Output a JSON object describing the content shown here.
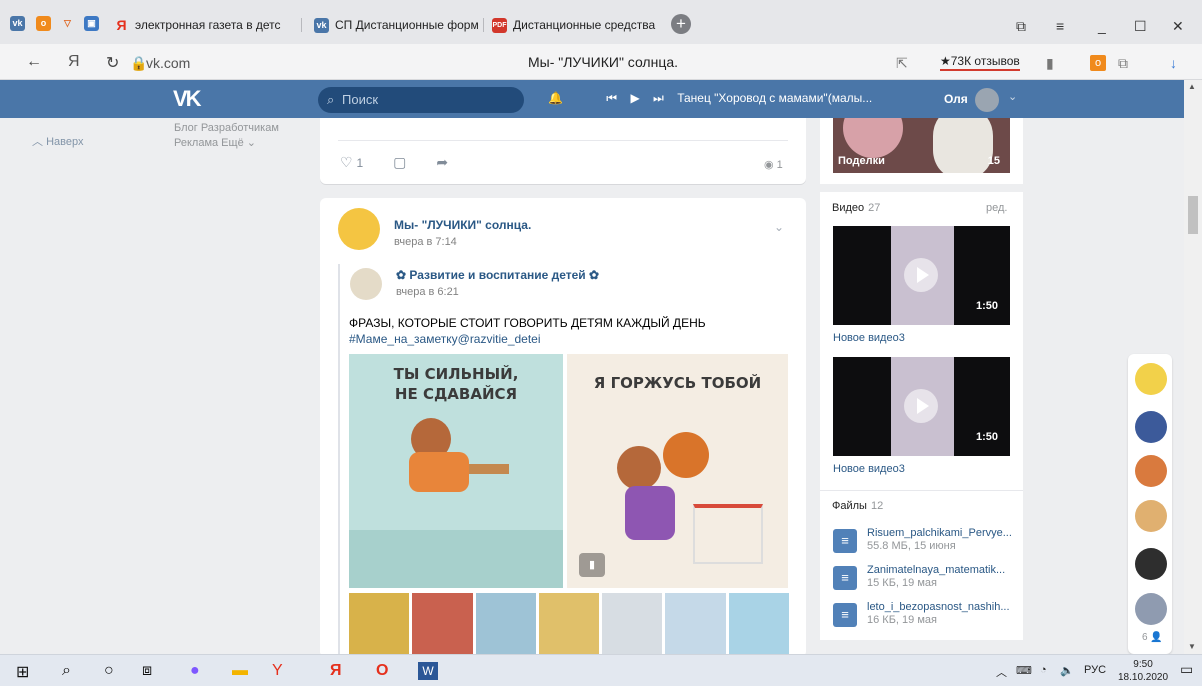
{
  "browser": {
    "tabs": [
      {
        "label": "электронная газета в детс",
        "icon": "yandex-icon",
        "color": "#e5301d"
      },
      {
        "label": "СП Дистанционные форм",
        "icon": "vk-icon",
        "color": "#4a76a8"
      },
      {
        "label": "Дистанционные средства",
        "icon": "pdf-icon",
        "color": "#d2372b"
      }
    ],
    "url": "vk.com",
    "page_title": "Мы- \"ЛУЧИКИ\" солнца.",
    "reviews": "★73К отзывов"
  },
  "vk": {
    "logo": "VK",
    "search_placeholder": "Поиск",
    "now_playing": "Танец \"Хоровод с мамами\"(малы...",
    "user_name": "Оля"
  },
  "sidebar": {
    "up_label": "Наверх",
    "footer_line1": "Блог  Разработчикам",
    "footer_line2": "Реклама  Ещё ⌄"
  },
  "prev_post": {
    "likes": "1",
    "views": "1"
  },
  "post": {
    "author": "Мы- \"ЛУЧИКИ\" солнца.",
    "time": "вчера в 7:14",
    "repost_author": "✿ Развитие и воспитание детей ✿",
    "repost_time": "вчера в 6:21",
    "text": "ФРАЗЫ, КОТОРЫЕ СТОИТ ГОВОРИТЬ ДЕТЯМ КАЖДЫЙ ДЕНЬ",
    "hashtag": "#Маме_на_заметку@razvitie_detei",
    "image1_caption": "ТЫ СИЛЬНЫЙ,\nНЕ СДАВАЙСЯ",
    "image2_caption": "Я ГОРЖУСЬ ТОБОЙ",
    "thumb_colors": [
      "#d8b24a",
      "#c9614f",
      "#9ec3d6",
      "#e0c06a",
      "#d7dde3",
      "#c5d9e8",
      "#a9d3e6"
    ]
  },
  "right": {
    "photos_label": "Поделки",
    "photos_count": "15",
    "videos_title": "Видео",
    "videos_count": "27",
    "edit_label": "ред.",
    "videos": [
      {
        "title": "Новое видео3",
        "duration": "1:50"
      },
      {
        "title": "Новое видео3",
        "duration": "1:50"
      }
    ],
    "files_title": "Файлы",
    "files_count": "12",
    "files": [
      {
        "name": "Risuem_palchikami_Pervye...",
        "meta": "55.8 МБ, 15 июня"
      },
      {
        "name": "Zanimatelnaya_matematik...",
        "meta": "15 КБ, 19 мая"
      },
      {
        "name": "leto_i_bezopasnost_nashih...",
        "meta": "16 КБ, 19 мая"
      }
    ]
  },
  "chat": {
    "online_count": "6",
    "avatar_colors": [
      "#f2d14a",
      "#3c5a9a",
      "#d97a3e",
      "#e0b070",
      "#2e2e2e",
      "#8f9bb0"
    ]
  },
  "taskbar": {
    "lang": "РУС",
    "time": "9:50",
    "date": "18.10.2020"
  }
}
